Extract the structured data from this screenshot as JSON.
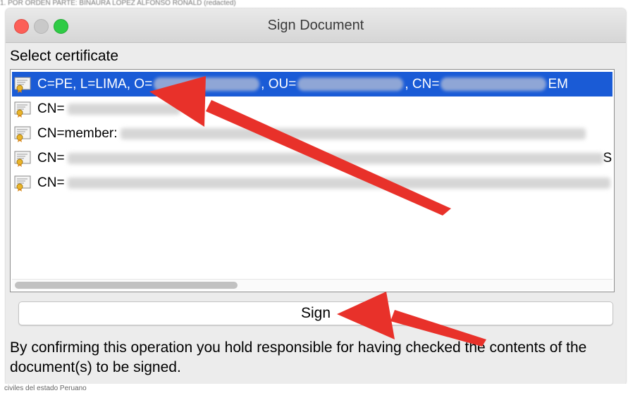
{
  "window": {
    "title": "Sign Document",
    "controls": [
      "close",
      "minimize",
      "maximize"
    ]
  },
  "background": {
    "top_text": "1. POR ORDEN PARTE: BINAURA LOPEZ ALFONSO RONALD (redacted)",
    "bottom_text": "civiles del estado Peruano"
  },
  "certificate_section": {
    "label": "Select certificate",
    "rows": [
      {
        "parts": [
          "C=PE, L=LIMA, O=",
          ", OU=",
          ", CN=",
          "EM"
        ],
        "selected": true
      },
      {
        "parts": [
          "CN="
        ],
        "selected": false
      },
      {
        "parts": [
          "CN=member:"
        ],
        "selected": false
      },
      {
        "parts": [
          "CN="
        ],
        "selected": false
      },
      {
        "parts": [
          "CN="
        ],
        "selected": false
      }
    ],
    "row_5_trailing": "S"
  },
  "sign_button": {
    "label": "Sign"
  },
  "disclaimer": "By confirming this operation you hold responsible for having checked the contents of the document(s) to be signed.",
  "colors": {
    "selection": "#1a5bd6",
    "annotation_arrow": "#e8312a"
  }
}
